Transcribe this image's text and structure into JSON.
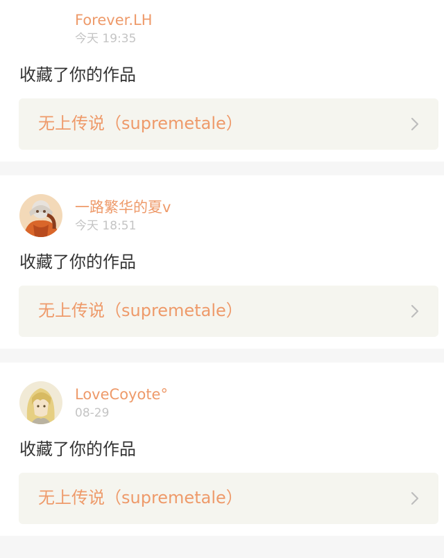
{
  "notifications": [
    {
      "username": "Forever.LH",
      "time": "今天 19:35",
      "action": "收藏了你的作品",
      "work_title": "无上传说（supremetale）",
      "avatar": "blank-avatar"
    },
    {
      "username": "一路繁华的夏v",
      "time": "今天 18:51",
      "action": "收藏了你的作品",
      "work_title": "无上传说（supremetale）",
      "avatar": "anime-character-orange-avatar"
    },
    {
      "username": "LoveCoyote°",
      "time": "08-29",
      "action": "收藏了你的作品",
      "work_title": "无上传说（supremetale）",
      "avatar": "anime-character-blonde-avatar"
    }
  ],
  "colors": {
    "accent": "#ee9a6a",
    "timestamp": "#c4c4c4",
    "body_text": "#333333",
    "work_card_bg": "#f5f5ef",
    "separator_bg": "#f6f6f6"
  },
  "icons": {
    "work_arrow": "chevron-right-icon"
  }
}
